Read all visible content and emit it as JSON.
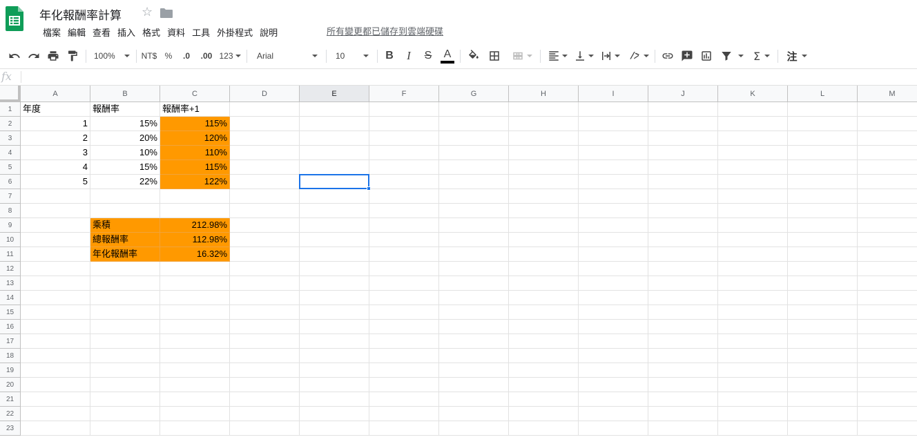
{
  "doc": {
    "title": "年化報酬率計算",
    "save_status": "所有變更都已儲存到雲端硬碟"
  },
  "menu": [
    "檔案",
    "編輯",
    "查看",
    "插入",
    "格式",
    "資料",
    "工具",
    "外掛程式",
    "說明"
  ],
  "toolbar": {
    "zoom": "100%",
    "currency": "NT$",
    "percent": "%",
    "decrease_decimal": ".0",
    "increase_decimal": ".00",
    "more_formats": "123",
    "font": "Arial",
    "font_size": "10",
    "bold": "B",
    "italic": "I",
    "strike": "S",
    "text_color_label": "A",
    "text_color": "#000000",
    "sum": "Σ",
    "input_tools": "注"
  },
  "formula_bar": {
    "fx": "fx",
    "value": ""
  },
  "columns": [
    "A",
    "B",
    "C",
    "D",
    "E",
    "F",
    "G",
    "H",
    "I",
    "J",
    "K",
    "L",
    "M"
  ],
  "rows": [
    "1",
    "2",
    "3",
    "4",
    "5",
    "6",
    "7",
    "8",
    "9",
    "10",
    "11",
    "12",
    "13",
    "14",
    "15",
    "16",
    "17",
    "18",
    "19",
    "20",
    "21",
    "22",
    "23"
  ],
  "selected_cell": "E6",
  "colors": {
    "highlight": "#ff9900",
    "selection": "#1a73e8",
    "logo": "#0f9d58"
  },
  "cells": {
    "A1": "年度",
    "B1": "報酬率",
    "C1": "報酬率+1",
    "A2": "1",
    "B2": "15%",
    "C2": "115%",
    "A3": "2",
    "B3": "20%",
    "C3": "120%",
    "A4": "3",
    "B4": "10%",
    "C4": "110%",
    "A5": "4",
    "B5": "15%",
    "C5": "115%",
    "A6": "5",
    "B6": "22%",
    "C6": "122%",
    "B9": "乘積",
    "C9": "212.98%",
    "B10": "總報酬率",
    "C10": "112.98%",
    "B11": "年化報酬率",
    "C11": "16.32%"
  }
}
